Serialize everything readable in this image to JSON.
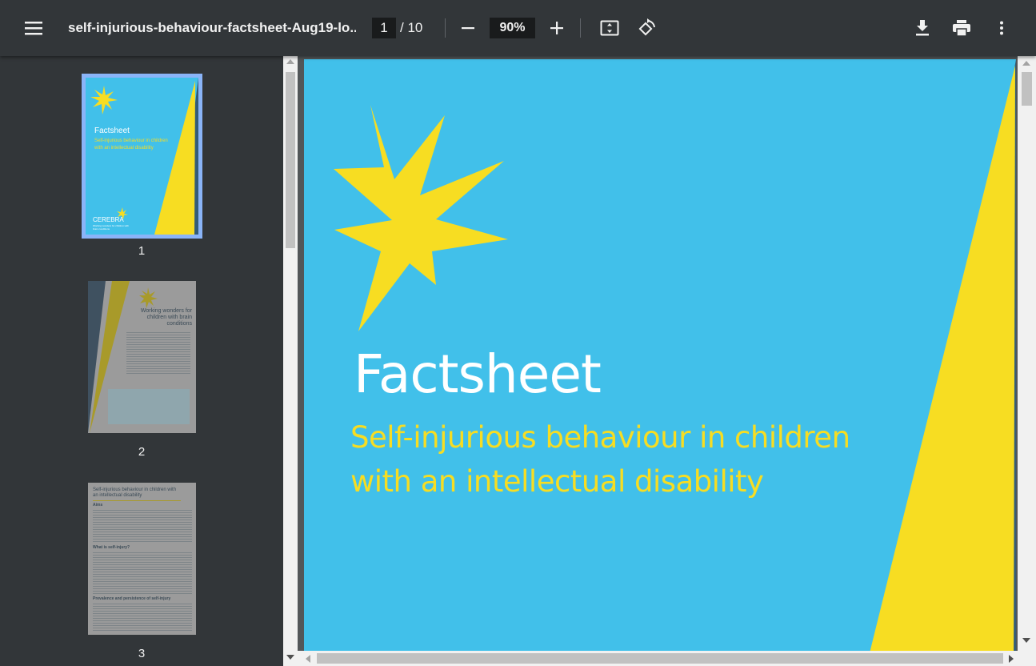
{
  "toolbar": {
    "title": "self-injurious-behaviour-factsheet-Aug19-lo...",
    "current_page": "1",
    "page_total": "/ 10",
    "zoom": "90%",
    "icons": [
      "menu-icon",
      "zoom-out-icon",
      "zoom-in-icon",
      "fit-page-icon",
      "rotate-icon",
      "download-icon",
      "print-icon",
      "more-vert-icon"
    ]
  },
  "sidebar": {
    "thumbnails": [
      {
        "number": "1",
        "selected": true
      },
      {
        "number": "2",
        "selected": false
      },
      {
        "number": "3",
        "selected": false
      }
    ],
    "thumb1": {
      "heading": "Factsheet",
      "sub1": "Self-injurious behaviour in children",
      "sub2": "with an intellectual disability",
      "brand": "CEREBRA",
      "tagline": "Working wonders for children with brain conditions"
    },
    "thumb2": {
      "heading": "Working wonders for children with brain conditions"
    },
    "thumb3": {
      "heading": "Self-injurious behaviour in children with an intellectual disability",
      "section1": "Aims",
      "section2": "What is self-injury?",
      "section3": "Prevalence and persistence of self-injury"
    }
  },
  "page": {
    "heading": "Factsheet",
    "subtitle_line1": "Self-injurious behaviour in children",
    "subtitle_line2": "with an intellectual disability"
  },
  "colors": {
    "page_bg": "#41c0ea",
    "accent_yellow": "#f7dd22",
    "dark_band": "#335c78",
    "toolbar": "#323639"
  }
}
